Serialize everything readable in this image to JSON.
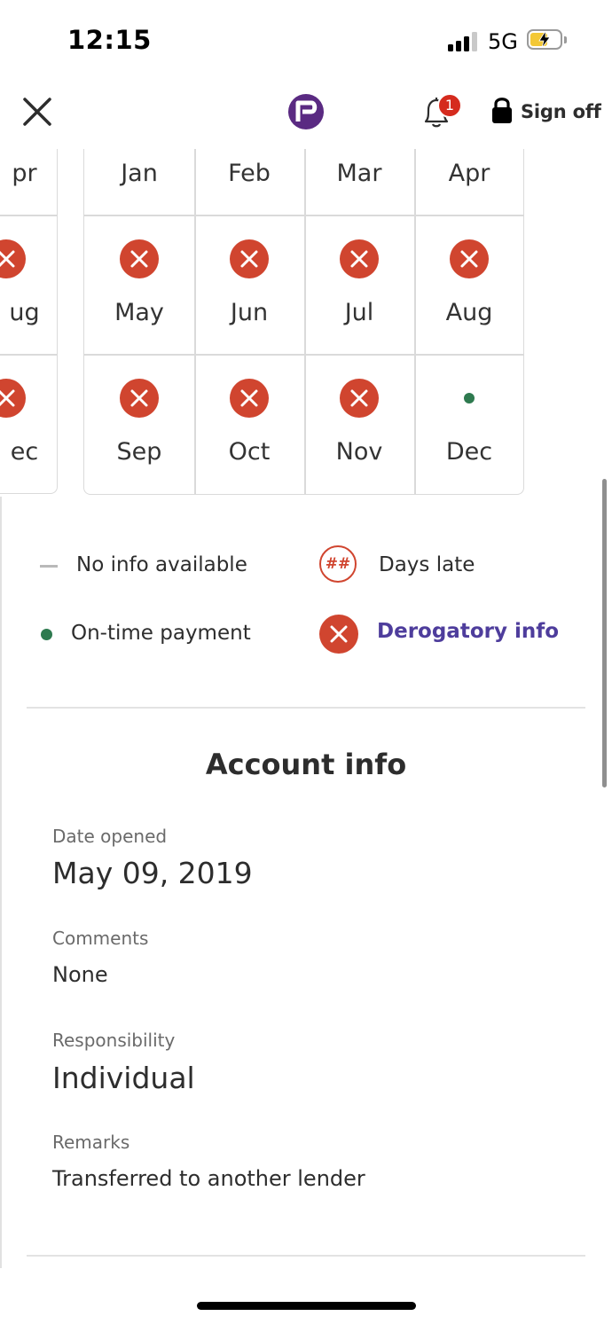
{
  "status_bar": {
    "time": "12:15",
    "network": "5G",
    "battery_level": 0.6,
    "signal_bars": 3
  },
  "header": {
    "close_icon": "close-icon",
    "brand_icon": "brand-logo-icon",
    "notification_count": "1",
    "signoff_label": "Sign off",
    "brand_color": "#5a2a82"
  },
  "payment_history": {
    "partial_column": {
      "months": [
        "pr",
        "ug",
        "ec"
      ],
      "statuses": [
        "none",
        "derogatory",
        "derogatory"
      ]
    },
    "grid": [
      [
        {
          "month": "Jan",
          "status": "none"
        },
        {
          "month": "Feb",
          "status": "none"
        },
        {
          "month": "Mar",
          "status": "none"
        },
        {
          "month": "Apr",
          "status": "none"
        }
      ],
      [
        {
          "month": "May",
          "status": "derogatory"
        },
        {
          "month": "Jun",
          "status": "derogatory"
        },
        {
          "month": "Jul",
          "status": "derogatory"
        },
        {
          "month": "Aug",
          "status": "derogatory"
        }
      ],
      [
        {
          "month": "Sep",
          "status": "derogatory"
        },
        {
          "month": "Oct",
          "status": "derogatory"
        },
        {
          "month": "Nov",
          "status": "derogatory"
        },
        {
          "month": "Dec",
          "status": "on-time"
        }
      ]
    ]
  },
  "legend": {
    "no_info": "No info available",
    "days_late_symbol": "##",
    "days_late": "Days late",
    "on_time": "On-time payment",
    "derogatory": "Derogatory info"
  },
  "colors": {
    "derogatory": "#d0452f",
    "on_time": "#2e7a4f",
    "link": "#4e3d9c"
  },
  "account_info": {
    "title": "Account info",
    "fields": [
      {
        "label": "Date opened",
        "value": "May 09, 2019"
      },
      {
        "label": "Comments",
        "value": "None"
      },
      {
        "label": "Responsibility",
        "value": "Individual"
      },
      {
        "label": "Remarks",
        "value": "Transferred to another lender"
      }
    ]
  }
}
